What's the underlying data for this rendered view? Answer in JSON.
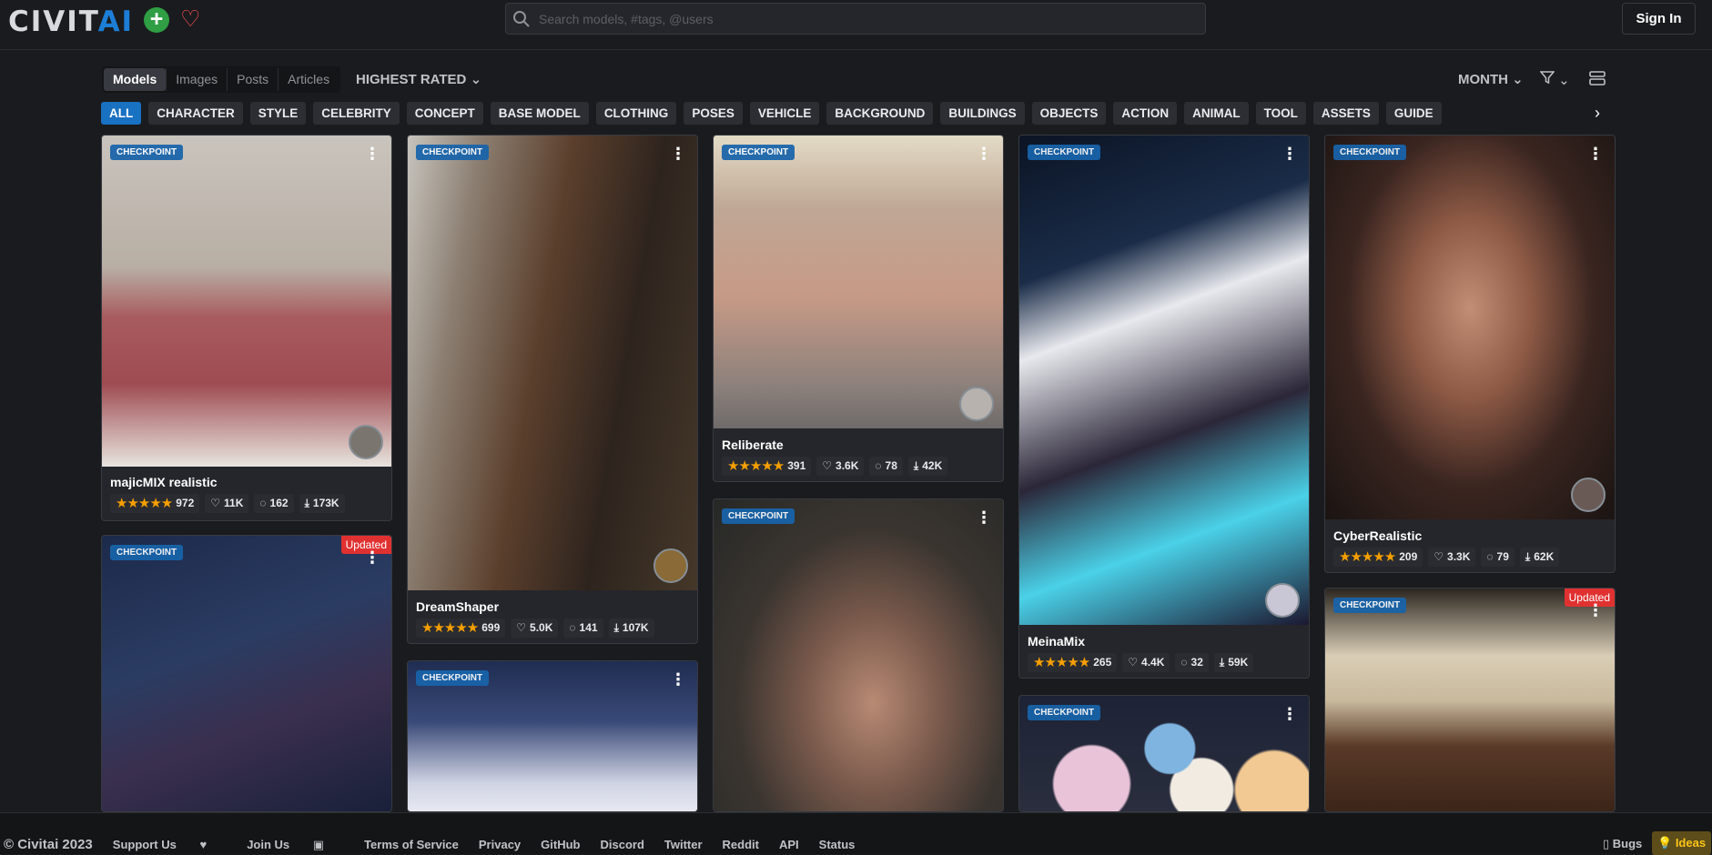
{
  "header": {
    "logo_civit": "CIVIT",
    "logo_ai": "AI",
    "search_placeholder": "Search models, #tags, @users",
    "signin_label": "Sign In"
  },
  "toolbar": {
    "tabs": [
      "Models",
      "Images",
      "Posts",
      "Articles"
    ],
    "active_tab": "Models",
    "sort_label": "HIGHEST RATED",
    "period_label": "MONTH"
  },
  "categories": [
    "ALL",
    "CHARACTER",
    "STYLE",
    "CELEBRITY",
    "CONCEPT",
    "BASE MODEL",
    "CLOTHING",
    "POSES",
    "VEHICLE",
    "BACKGROUND",
    "BUILDINGS",
    "OBJECTS",
    "ACTION",
    "ANIMAL",
    "TOOL",
    "ASSETS",
    "GUIDE"
  ],
  "cards": [
    {
      "badge": "CHECKPOINT",
      "title": "majicMIX realistic",
      "rating_count": "972",
      "likes": "11K",
      "comments": "162",
      "downloads": "173K"
    },
    {
      "badge": "CHECKPOINT",
      "updated": "Updated"
    },
    {
      "badge": "CHECKPOINT",
      "title": "DreamShaper",
      "rating_count": "699",
      "likes": "5.0K",
      "comments": "141",
      "downloads": "107K"
    },
    {
      "badge": "CHECKPOINT"
    },
    {
      "badge": "CHECKPOINT",
      "title": "Reliberate",
      "rating_count": "391",
      "likes": "3.6K",
      "comments": "78",
      "downloads": "42K"
    },
    {
      "badge": "CHECKPOINT"
    },
    {
      "badge": "CHECKPOINT",
      "title": "MeinaMix",
      "rating_count": "265",
      "likes": "4.4K",
      "comments": "32",
      "downloads": "59K"
    },
    {
      "badge": "CHECKPOINT"
    },
    {
      "badge": "CHECKPOINT",
      "title": "CyberRealistic",
      "rating_count": "209",
      "likes": "3.3K",
      "comments": "79",
      "downloads": "62K"
    },
    {
      "badge": "CHECKPOINT",
      "updated": "Updated"
    }
  ],
  "footer": {
    "copyright": "© Civitai 2023",
    "support": "Support Us",
    "join": "Join Us",
    "links": [
      "Terms of Service",
      "Privacy",
      "GitHub",
      "Discord",
      "Twitter",
      "Reddit",
      "API",
      "Status"
    ],
    "bugs": "Bugs",
    "ideas": "Ideas"
  }
}
